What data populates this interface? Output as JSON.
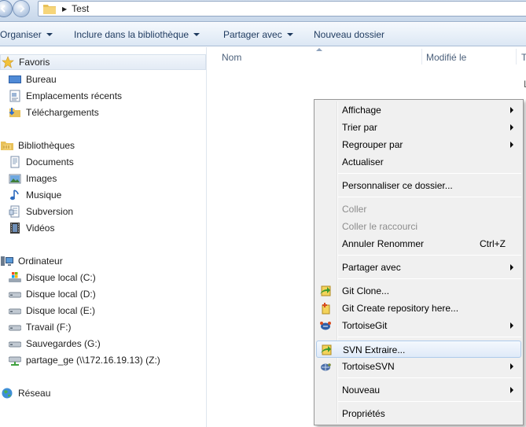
{
  "address": {
    "path": "Test"
  },
  "toolbar": {
    "organiser": "Organiser",
    "inclure": "Inclure dans la bibliothèque",
    "partager": "Partager avec",
    "nouveau_dossier": "Nouveau dossier"
  },
  "nav": {
    "favoris": "Favoris",
    "bureau": "Bureau",
    "emplacements": "Emplacements récents",
    "telechargements": "Téléchargements",
    "bibliotheques": "Bibliothèques",
    "documents": "Documents",
    "images": "Images",
    "musique": "Musique",
    "subversion": "Subversion",
    "videos": "Vidéos",
    "ordinateur": "Ordinateur",
    "disque_c": "Disque local (C:)",
    "disque_d": "Disque local (D:)",
    "disque_e": "Disque local (E:)",
    "travail": "Travail (F:)",
    "sauvegardes": "Sauvegardes (G:)",
    "partage": "partage_ge (\\\\172.16.19.13) (Z:)",
    "reseau": "Réseau"
  },
  "columns": {
    "nom": "Nom",
    "modifie": "Modifié le",
    "type": "T",
    "partial_letter": "L"
  },
  "menu": {
    "affichage": "Affichage",
    "trier": "Trier par",
    "regrouper": "Regrouper par",
    "actualiser": "Actualiser",
    "personnaliser": "Personnaliser ce dossier...",
    "coller": "Coller",
    "coller_raccourci": "Coller le raccourci",
    "annuler": "Annuler Renommer",
    "annuler_shortcut": "Ctrl+Z",
    "partager": "Partager avec",
    "git_clone": "Git Clone...",
    "git_create": "Git Create repository here...",
    "tortoisegit": "TortoiseGit",
    "svn_extraire": "SVN Extraire...",
    "tortoisesvn": "TortoiseSVN",
    "nouveau": "Nouveau",
    "proprietes": "Propriétés"
  },
  "colors": {
    "hover_border": "#aecbeb",
    "toolbar_text": "#1e3a5f",
    "disabled_text": "#8d8d8d"
  }
}
